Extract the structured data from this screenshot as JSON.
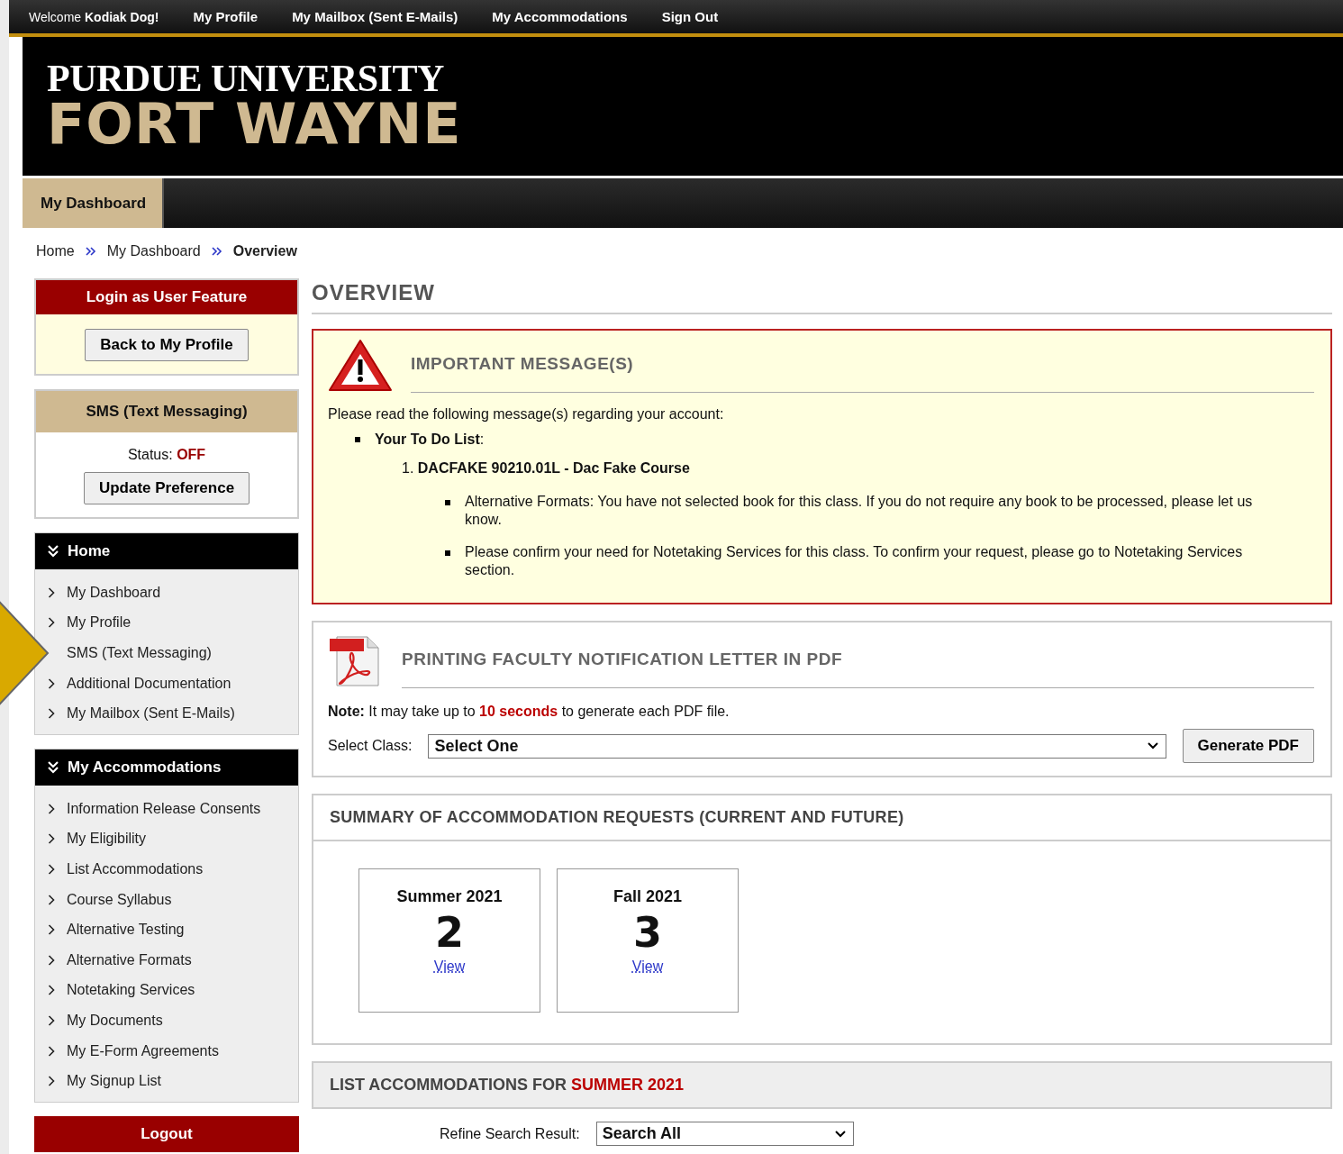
{
  "top_bar": {
    "welcome": "Welcome",
    "user": "Kodiak Dog!",
    "links": [
      "My Profile",
      "My Mailbox (Sent E-Mails)",
      "My Accommodations",
      "Sign Out"
    ]
  },
  "logo": {
    "line1": "PURDUE UNIVERSITY",
    "line2": "FORT WAYNE"
  },
  "nav_tabs": [
    {
      "label": "My Dashboard",
      "selected": true
    }
  ],
  "breadcrumbs": [
    {
      "label": "Home",
      "current": false
    },
    {
      "label": "My Dashboard",
      "current": false
    },
    {
      "label": "Overview",
      "current": true
    }
  ],
  "login_feature": {
    "title": "Login as User Feature",
    "button": "Back to My Profile"
  },
  "sms": {
    "title": "SMS (Text Messaging)",
    "status_label": "Status:",
    "status_value": "OFF",
    "button": "Update Preference"
  },
  "menus": [
    {
      "title": "Home",
      "items": [
        {
          "label": "My Dashboard",
          "pointed": false
        },
        {
          "label": "My Profile",
          "pointed": false
        },
        {
          "label": "SMS (Text Messaging)",
          "pointed": true
        },
        {
          "label": "Additional Documentation",
          "pointed": false
        },
        {
          "label": "My Mailbox (Sent E-Mails)",
          "pointed": false
        }
      ]
    },
    {
      "title": "My Accommodations",
      "items": [
        {
          "label": "Information Release Consents",
          "pointed": false
        },
        {
          "label": "My Eligibility",
          "pointed": false
        },
        {
          "label": "List Accommodations",
          "pointed": false
        },
        {
          "label": "Course Syllabus",
          "pointed": false
        },
        {
          "label": "Alternative Testing",
          "pointed": false
        },
        {
          "label": "Alternative Formats",
          "pointed": false
        },
        {
          "label": "Notetaking Services",
          "pointed": false
        },
        {
          "label": "My Documents",
          "pointed": false
        },
        {
          "label": "My E-Form Agreements",
          "pointed": false
        },
        {
          "label": "My Signup List",
          "pointed": false
        }
      ]
    }
  ],
  "logout": "Logout",
  "page_title": "OVERVIEW",
  "important": {
    "title": "IMPORTANT MESSAGE(S)",
    "intro": "Please read the following message(s) regarding your account:",
    "todo_label": "**Your To Do List**:",
    "course_number": "1.",
    "course": "DACFAKE 90210.01L - Dac Fake Course",
    "messages": [
      "Alternative Formats: You have not selected book for this class. If you do not require any book to be processed, please let us know.",
      "Please confirm your need for Notetaking Services for this class. To confirm your request, please go to Notetaking Services section."
    ]
  },
  "pdf": {
    "title": "PRINTING FACULTY NOTIFICATION LETTER IN PDF",
    "note_label": "Note:",
    "note_before": " It may take up to ",
    "note_highlight": "10 seconds",
    "note_after": " to generate each PDF file.",
    "select_label": "Select Class:",
    "select_value": "Select One",
    "button": "Generate PDF"
  },
  "summary": {
    "title": "SUMMARY OF ACCOMMODATION REQUESTS (CURRENT AND FUTURE)",
    "terms": [
      {
        "term": "Summer 2021",
        "count": "2",
        "link": "View"
      },
      {
        "term": "Fall 2021",
        "count": "3",
        "link": "View"
      }
    ]
  },
  "list": {
    "title": "LIST ACCOMMODATIONS FOR",
    "term": "SUMMER 2021",
    "refine_label": "Refine Search Result:",
    "refine_value": "Search All"
  }
}
